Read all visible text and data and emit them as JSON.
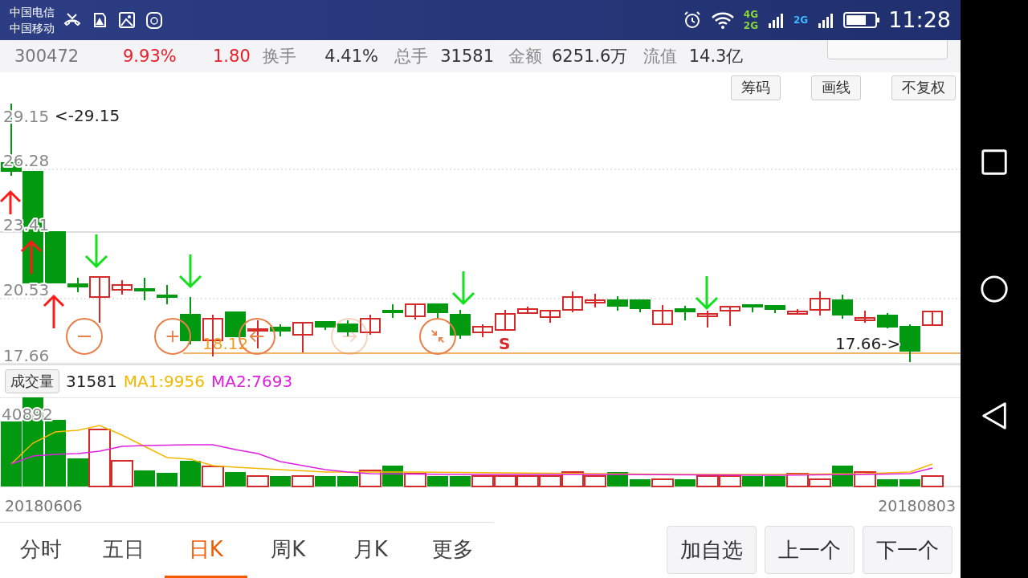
{
  "status_bar": {
    "carriers": [
      "中国电信",
      "中国移动"
    ],
    "network_labels": [
      "4G",
      "2G",
      "2G"
    ],
    "time": "11:28"
  },
  "quote_bar": {
    "code": "300472",
    "change_pct": "9.93%",
    "change": "1.80",
    "stats": [
      {
        "label": "换手",
        "value": "4.41%"
      },
      {
        "label": "总手",
        "value": "31581"
      },
      {
        "label": "金额",
        "value": "6251.6万"
      },
      {
        "label": "流值",
        "value": "14.3亿"
      }
    ]
  },
  "chart_tools": [
    "筹码",
    "画线",
    "不复权"
  ],
  "price_chart": {
    "axis_labels": [
      "29.15",
      "26.28",
      "23.41",
      "20.53",
      "17.66"
    ],
    "high_label": "<-29.15",
    "low_label": "17.66->",
    "cost_label": "18.12",
    "signal_label": "S"
  },
  "chart_controls": [
    {
      "kind": "zoom-out",
      "disabled": false
    },
    {
      "kind": "zoom-in",
      "disabled": false
    },
    {
      "kind": "prev",
      "disabled": false
    },
    {
      "kind": "next",
      "disabled": true
    },
    {
      "kind": "reset",
      "disabled": false
    }
  ],
  "volume": {
    "button": "成交量",
    "value": "31581",
    "ma1": "MA1:9956",
    "ma2": "MA2:7693",
    "axis_label": "40892"
  },
  "dates": {
    "start": "20180606",
    "end": "20180803"
  },
  "period_tabs": [
    {
      "label": "分时",
      "selected": false
    },
    {
      "label": "五日",
      "selected": false
    },
    {
      "label": "日K",
      "selected": true
    },
    {
      "label": "周K",
      "selected": false
    },
    {
      "label": "月K",
      "selected": false
    },
    {
      "label": "更多",
      "selected": false
    }
  ],
  "actions": [
    "加自选",
    "上一个",
    "下一个"
  ]
}
